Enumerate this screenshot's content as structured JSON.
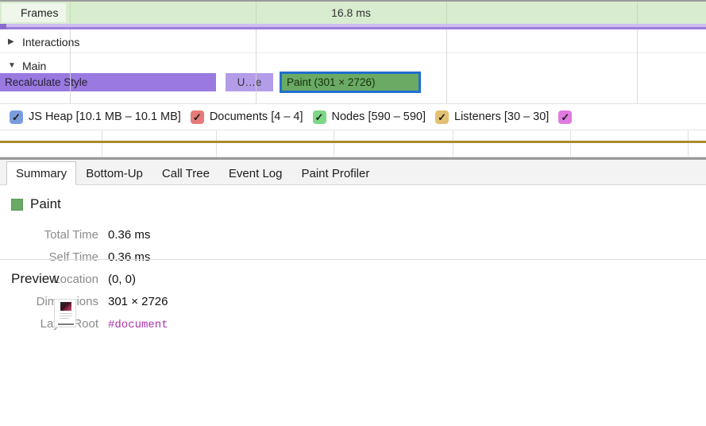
{
  "timeline": {
    "frames_track": {
      "label": "Frames",
      "frame_duration": "16.8 ms",
      "background_color": "#d8ecd0"
    },
    "tracks": [
      {
        "name": "Interactions",
        "twisty": "▶",
        "expanded": false
      },
      {
        "name": "Main",
        "twisty": "▼",
        "expanded": true
      }
    ],
    "events": [
      {
        "label": "Recalculate Style",
        "type": "style",
        "color": "#9a79e0",
        "selected": false
      },
      {
        "label": "U…e",
        "type": "update-layer-tree",
        "color": "#b39ce8",
        "selected": false
      },
      {
        "label": "Paint (301 × 2726)",
        "type": "paint",
        "color": "#6aaa64",
        "selected": true,
        "selection_color": "#1f6fcf"
      }
    ]
  },
  "counters": [
    {
      "label": "JS Heap [10.1 MB – 10.1 MB]",
      "checked": true,
      "color": "#7a9cdd"
    },
    {
      "label": "Documents [4 – 4]",
      "checked": true,
      "color": "#e57a78"
    },
    {
      "label": "Nodes [590 – 590]",
      "checked": true,
      "color": "#7ed687"
    },
    {
      "label": "Listeners [30 – 30]",
      "checked": true,
      "color": "#e3c174"
    },
    {
      "label": "",
      "checked": true,
      "color": "#e07ae0"
    }
  ],
  "counter_chart": {
    "series_color": "#ab8a2c"
  },
  "drawer": {
    "tabs": [
      {
        "label": "Summary",
        "active": true
      },
      {
        "label": "Bottom-Up",
        "active": false
      },
      {
        "label": "Call Tree",
        "active": false
      },
      {
        "label": "Event Log",
        "active": false
      },
      {
        "label": "Paint Profiler",
        "active": false
      }
    ],
    "summary": {
      "event_name": "Paint",
      "event_color": "#6aaa64",
      "details": [
        {
          "key": "Total Time",
          "value": "0.36 ms",
          "mono": false
        },
        {
          "key": "Self Time",
          "value": "0.36 ms",
          "mono": false
        },
        {
          "key": "Location",
          "value": "(0, 0)",
          "mono": false
        },
        {
          "key": "Dimensions",
          "value": "301 × 2726",
          "mono": false
        },
        {
          "key": "Layer Root",
          "value": "#document",
          "mono": true
        }
      ]
    },
    "preview": {
      "title": "Preview"
    }
  }
}
